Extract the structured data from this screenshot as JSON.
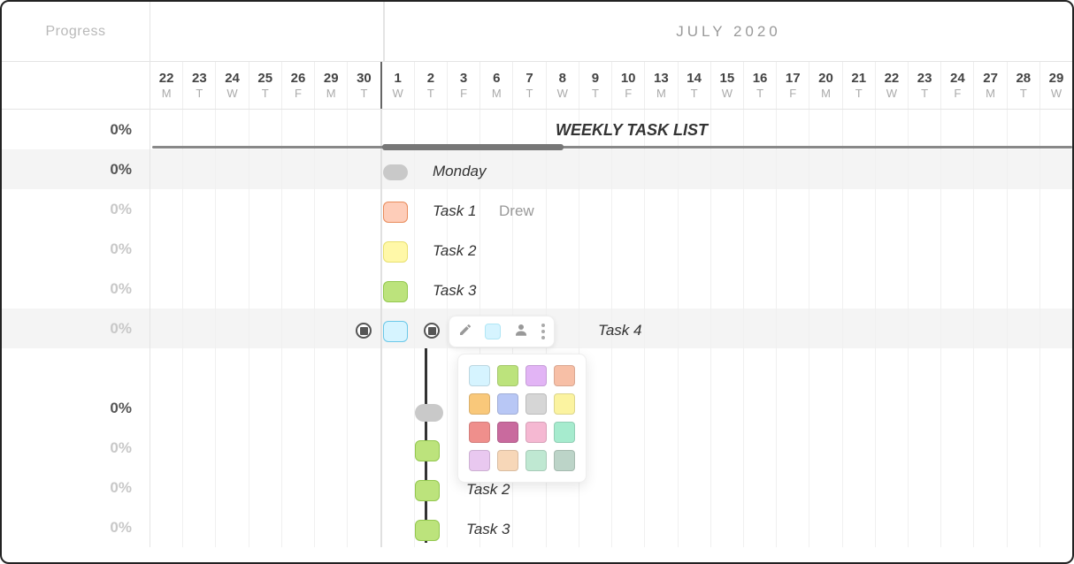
{
  "header": {
    "progress_label": "Progress",
    "month": "JULY 2020"
  },
  "days": [
    {
      "n": "22",
      "d": "M"
    },
    {
      "n": "23",
      "d": "T"
    },
    {
      "n": "24",
      "d": "W"
    },
    {
      "n": "25",
      "d": "T"
    },
    {
      "n": "26",
      "d": "F"
    },
    {
      "n": "29",
      "d": "M"
    },
    {
      "n": "30",
      "d": "T"
    },
    {
      "n": "1",
      "d": "W"
    },
    {
      "n": "2",
      "d": "T"
    },
    {
      "n": "3",
      "d": "F"
    },
    {
      "n": "6",
      "d": "M"
    },
    {
      "n": "7",
      "d": "T"
    },
    {
      "n": "8",
      "d": "W"
    },
    {
      "n": "9",
      "d": "T"
    },
    {
      "n": "10",
      "d": "F"
    },
    {
      "n": "13",
      "d": "M"
    },
    {
      "n": "14",
      "d": "T"
    },
    {
      "n": "15",
      "d": "W"
    },
    {
      "n": "16",
      "d": "T"
    },
    {
      "n": "17",
      "d": "F"
    },
    {
      "n": "20",
      "d": "M"
    },
    {
      "n": "21",
      "d": "T"
    },
    {
      "n": "22",
      "d": "W"
    },
    {
      "n": "23",
      "d": "T"
    },
    {
      "n": "24",
      "d": "F"
    },
    {
      "n": "27",
      "d": "M"
    },
    {
      "n": "28",
      "d": "T"
    },
    {
      "n": "29",
      "d": "W"
    }
  ],
  "rows": [
    {
      "pct": "0%",
      "dim": false,
      "shade": false
    },
    {
      "pct": "0%",
      "dim": false,
      "shade": true
    },
    {
      "pct": "0%",
      "dim": true,
      "shade": false
    },
    {
      "pct": "0%",
      "dim": true,
      "shade": false
    },
    {
      "pct": "0%",
      "dim": true,
      "shade": false
    },
    {
      "pct": "0%",
      "dim": true,
      "shade": true
    },
    {
      "pct": "",
      "dim": true,
      "shade": false
    },
    {
      "pct": "0%",
      "dim": false,
      "shade": false
    },
    {
      "pct": "0%",
      "dim": true,
      "shade": false
    },
    {
      "pct": "0%",
      "dim": true,
      "shade": false
    },
    {
      "pct": "0%",
      "dim": true,
      "shade": false
    }
  ],
  "gantt": {
    "title": "WEEKLY TASK LIST",
    "monday": "Monday",
    "task1": "Task 1",
    "task1_assignee": "Drew",
    "task2": "Task 2",
    "task3": "Task 3",
    "task4": "Task 4",
    "b_task2": "Task 2",
    "b_task3": "Task 3"
  },
  "palette_colors": [
    "#d6f4ff",
    "#bce37c",
    "#e2b4f5",
    "#f7bfa6",
    "#f9c87a",
    "#b8c7f5",
    "#d6d6d6",
    "#fbf3a0",
    "#ef8f8c",
    "#c96a9e",
    "#f5b8d2",
    "#a6ebce",
    "#e9c8f0",
    "#f7d7b8",
    "#bfe8d2",
    "#bcd4c8"
  ]
}
